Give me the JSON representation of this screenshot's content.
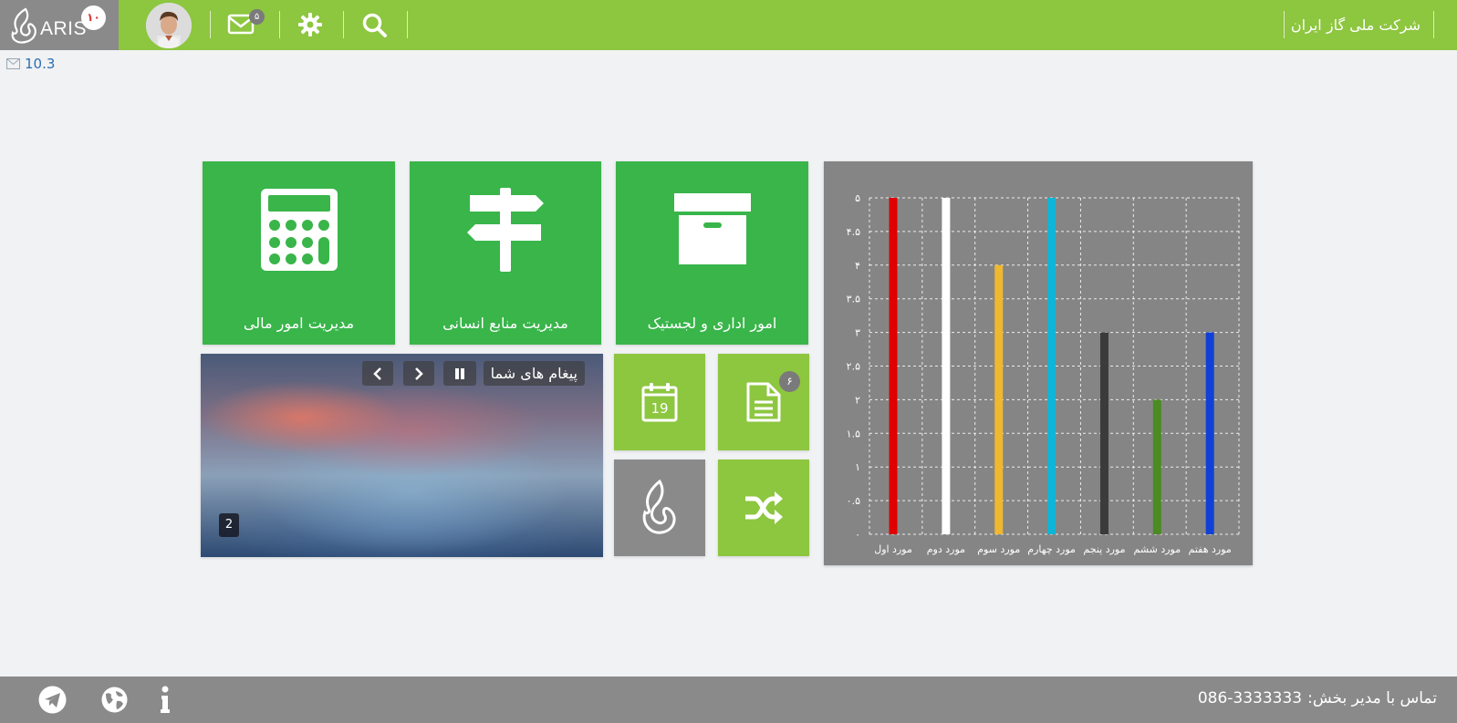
{
  "header": {
    "logo_text": "ARIS",
    "logo_badge": "۱۰",
    "mail_badge": "۵",
    "company": "شرکت ملی گاز ایران"
  },
  "version": "10.3",
  "tiles": {
    "finance": "مدیریت امور مالی",
    "hr": "مدیریت منابع انسانی",
    "admin": "امور اداری و لجستیک",
    "calendar_day": "19",
    "doc_badge": "۶"
  },
  "slider": {
    "title": "پیغام های شما",
    "page": "2"
  },
  "colors": {
    "topbar": "#8dc63f",
    "tile_big": "#39b54a",
    "tile_small": "#8dc63f",
    "gray": "#8a8a8a"
  },
  "chart_data": {
    "type": "bar",
    "categories": [
      "مورد اول",
      "مورد دوم",
      "مورد سوم",
      "مورد چهارم",
      "مورد پنجم",
      "مورد ششم",
      "مورد هفتم"
    ],
    "values": [
      5,
      5,
      4,
      5,
      3,
      2,
      3
    ],
    "colors": [
      "#e00000",
      "#ffffff",
      "#f0b731",
      "#0fb5d6",
      "#3d3a3a",
      "#4b8b22",
      "#1040d6"
    ],
    "y_ticks": [
      "۰",
      "۰.۵",
      "۱",
      "۱.۵",
      "۲",
      "۲.۵",
      "۳",
      "۳.۵",
      "۴",
      "۴.۵",
      "۵"
    ],
    "ylim": [
      0,
      5
    ],
    "grid": true,
    "title": "",
    "xlabel": "",
    "ylabel": ""
  },
  "footer": {
    "contact_label": "تماس با مدیر بخش:",
    "contact_phone": "086-3333333"
  }
}
